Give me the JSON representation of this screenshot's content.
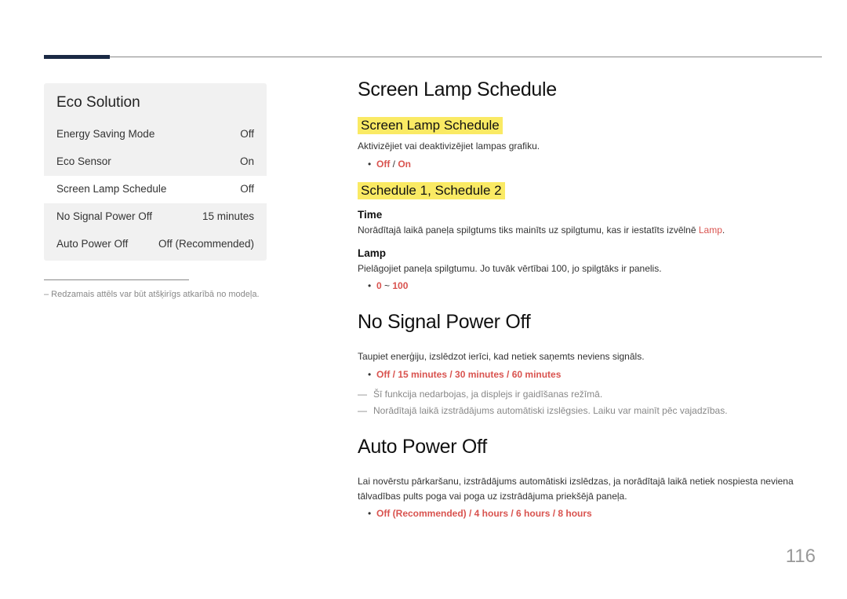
{
  "sidebar": {
    "title": "Eco Solution",
    "items": [
      {
        "label": "Energy Saving Mode",
        "value": "Off",
        "selected": false
      },
      {
        "label": "Eco Sensor",
        "value": "On",
        "selected": false
      },
      {
        "label": "Screen Lamp Schedule",
        "value": "Off",
        "selected": true
      },
      {
        "label": "No Signal Power Off",
        "value": "15 minutes",
        "selected": false
      },
      {
        "label": "Auto Power Off",
        "value": "Off (Recommended)",
        "selected": false
      }
    ],
    "note": "– Redzamais attēls var būt atšķirīgs atkarībā no modeļa."
  },
  "content": {
    "screenLamp": {
      "heading": "Screen Lamp Schedule",
      "sub1": "Screen Lamp Schedule",
      "desc1": "Aktivizējiet vai deaktivizējiet lampas grafiku.",
      "opts1_a": "Off",
      "opts1_sep": " / ",
      "opts1_b": "On",
      "sub2": "Schedule 1, Schedule 2",
      "timeHeading": "Time",
      "timeDesc_a": "Norādītajā laikā paneļa spilgtums tiks mainīts uz spilgtumu, kas ir iestatīts izvēlnē ",
      "timeDesc_b": "Lamp",
      "timeDesc_c": ".",
      "lampHeading": "Lamp",
      "lampDesc": "Pielāgojiet paneļa spilgtumu. Jo tuvāk vērtībai 100, jo spilgtāks ir panelis.",
      "lampRange_a": "0",
      "lampRange_tilde": " ~ ",
      "lampRange_b": "100"
    },
    "noSignal": {
      "heading": "No Signal Power Off",
      "desc": "Taupiet enerģiju, izslēdzot ierīci, kad netiek saņemts neviens signāls.",
      "opts": "Off / 15 minutes / 30 minutes / 60 minutes",
      "note1": "Šī funkcija nedarbojas, ja displejs ir gaidīšanas režīmā.",
      "note2": "Norādītajā laikā izstrādājums automātiski izslēgsies. Laiku var mainīt pēc vajadzības."
    },
    "autoPower": {
      "heading": "Auto Power Off",
      "desc": "Lai novērstu pārkaršanu, izstrādājums automātiski izslēdzas, ja norādītajā laikā netiek nospiesta neviena tālvadības pults poga vai poga uz izstrādājuma priekšējā paneļa.",
      "opts": "Off (Recommended) / 4 hours / 6 hours / 8 hours"
    }
  },
  "pageNumber": "116"
}
